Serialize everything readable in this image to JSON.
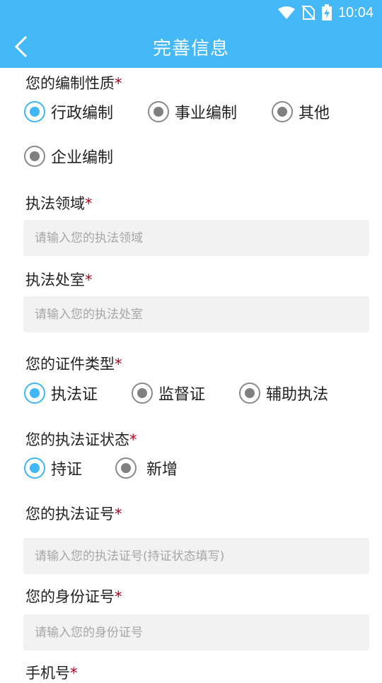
{
  "status": {
    "time": "10:04"
  },
  "header": {
    "title": "完善信息"
  },
  "form": {
    "required_mark": "*",
    "bianzhi": {
      "label": "您的编制性质",
      "options": [
        "行政编制",
        "事业编制",
        "其他",
        "企业编制"
      ],
      "selected": 0
    },
    "zhifa_lingyu": {
      "label": "执法领域",
      "placeholder": "请输入您的执法领域",
      "value": ""
    },
    "zhifa_chushi": {
      "label": "执法处室",
      "placeholder": "请输入您的执法处室",
      "value": ""
    },
    "zhengjian": {
      "label": "您的证件类型",
      "options": [
        "执法证",
        "监督证",
        "辅助执法"
      ],
      "selected": 0
    },
    "zhifazheng_zhuangtai": {
      "label": "您的执法证状态",
      "options": [
        "持证",
        "新增"
      ],
      "selected": 0
    },
    "zhifazheng_hao": {
      "label": "您的执法证号",
      "placeholder": "请输入您的执法证号(持证状态填写)",
      "value": ""
    },
    "shenfenzheng": {
      "label": "您的身份证号",
      "placeholder": "请输入您的身份证号",
      "value": ""
    },
    "shouji": {
      "label": "手机号"
    }
  },
  "colors": {
    "header_bg": "#45b9f7",
    "accent": "#3fb6f5",
    "required": "#b00020",
    "input_bg": "#f2f2f2"
  }
}
